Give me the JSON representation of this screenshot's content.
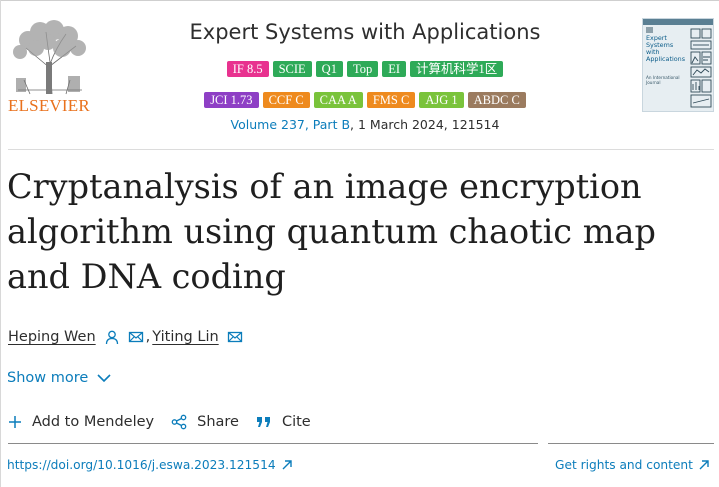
{
  "publisher": {
    "name": "ELSEVIER",
    "color": "#e9711c"
  },
  "journal": {
    "title": "Expert Systems with Applications",
    "volume_link": "Volume 237, Part B",
    "volume_rest": ", 1 March 2024, 121514"
  },
  "badges_row1": [
    {
      "label": "IF 8.5",
      "color": "#e8328f"
    },
    {
      "label": "SCIE",
      "color": "#2eaa58"
    },
    {
      "label": "Q1",
      "color": "#2eaa58"
    },
    {
      "label": "Top",
      "color": "#2eaa58"
    },
    {
      "label": "EI",
      "color": "#2eaa58"
    },
    {
      "label": "计算机科学1区",
      "color": "#2eaa58"
    }
  ],
  "badges_row2": [
    {
      "label": "JCI 1.73",
      "color": "#8e3fc5"
    },
    {
      "label": "CCF C",
      "color": "#ee8a1e"
    },
    {
      "label": "CAA A",
      "color": "#7ac33b"
    },
    {
      "label": "FMS C",
      "color": "#ee8a1e"
    },
    {
      "label": "AJG 1",
      "color": "#7ac33b"
    },
    {
      "label": "ABDC C",
      "color": "#9b7b5f"
    }
  ],
  "cover": {
    "title": "Expert Systems with Applications",
    "subtitle": "An International Journal",
    "accent": "#0e5e8a"
  },
  "article": {
    "title": "Cryptanalysis of an image encryption algorithm using quantum chaotic map and DNA coding"
  },
  "authors": [
    {
      "name": "Heping Wen",
      "icons": [
        "person-icon",
        "mail-icon"
      ]
    },
    {
      "name": "Yiting Lin",
      "icons": [
        "mail-icon"
      ]
    }
  ],
  "author_separator": ",",
  "show_more": "Show more",
  "actions": {
    "mendeley": "Add to Mendeley",
    "share": "Share",
    "cite": "Cite"
  },
  "links": {
    "doi": "https://doi.org/10.1016/j.eswa.2023.121514",
    "rights": "Get rights and content"
  },
  "colors": {
    "link": "#0c7dbb",
    "text": "#1f1f1f"
  }
}
